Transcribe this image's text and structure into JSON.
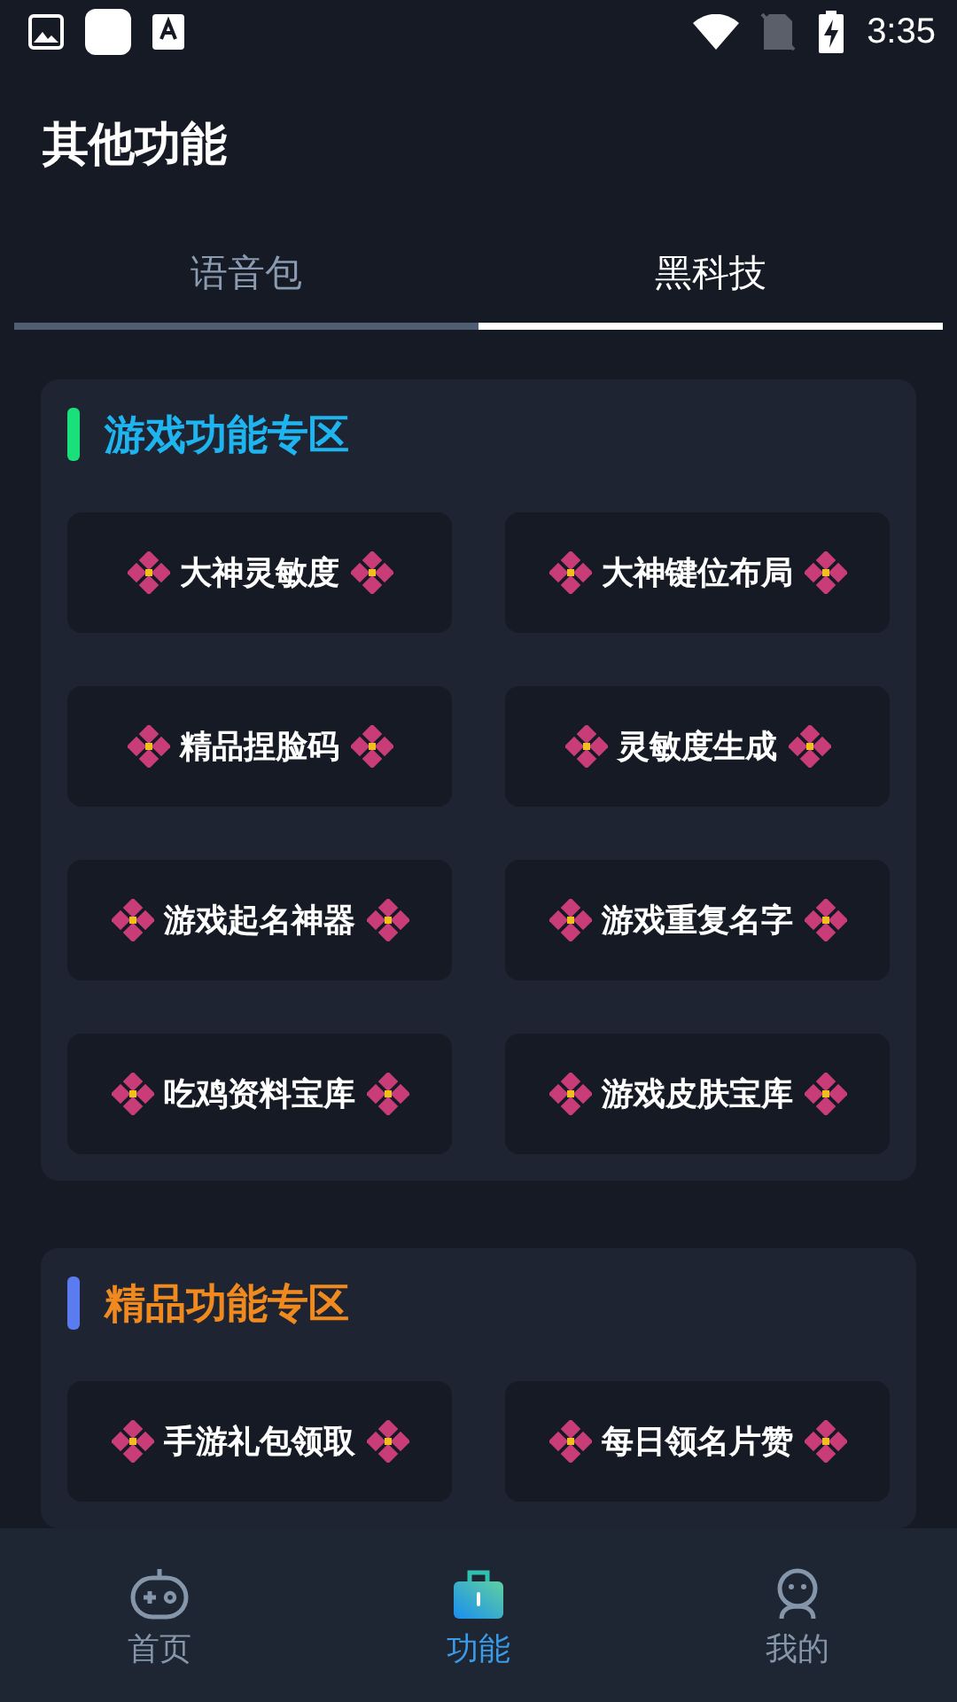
{
  "status_bar": {
    "time": "3:35"
  },
  "header": {
    "title": "其他功能"
  },
  "tabs": [
    {
      "label": "语音包",
      "selected": false
    },
    {
      "label": "黑科技",
      "selected": true
    }
  ],
  "sections": [
    {
      "title": "游戏功能专区",
      "color": "#19e07a",
      "kind": "games",
      "items": [
        "大神灵敏度",
        "大神键位布局",
        "精品捏脸码",
        "灵敏度生成",
        "游戏起名神器",
        "游戏重复名字",
        "吃鸡资料宝库",
        "游戏皮肤宝库"
      ]
    },
    {
      "title": "精品功能专区",
      "color": "#5b7cf0",
      "kind": "premium",
      "items": [
        "手游礼包领取",
        "每日领名片赞"
      ]
    }
  ],
  "nav": [
    {
      "label": "首页",
      "kind": "home",
      "selected": false
    },
    {
      "label": "功能",
      "kind": "tools",
      "selected": true
    },
    {
      "label": "我的",
      "kind": "me",
      "selected": false
    }
  ]
}
